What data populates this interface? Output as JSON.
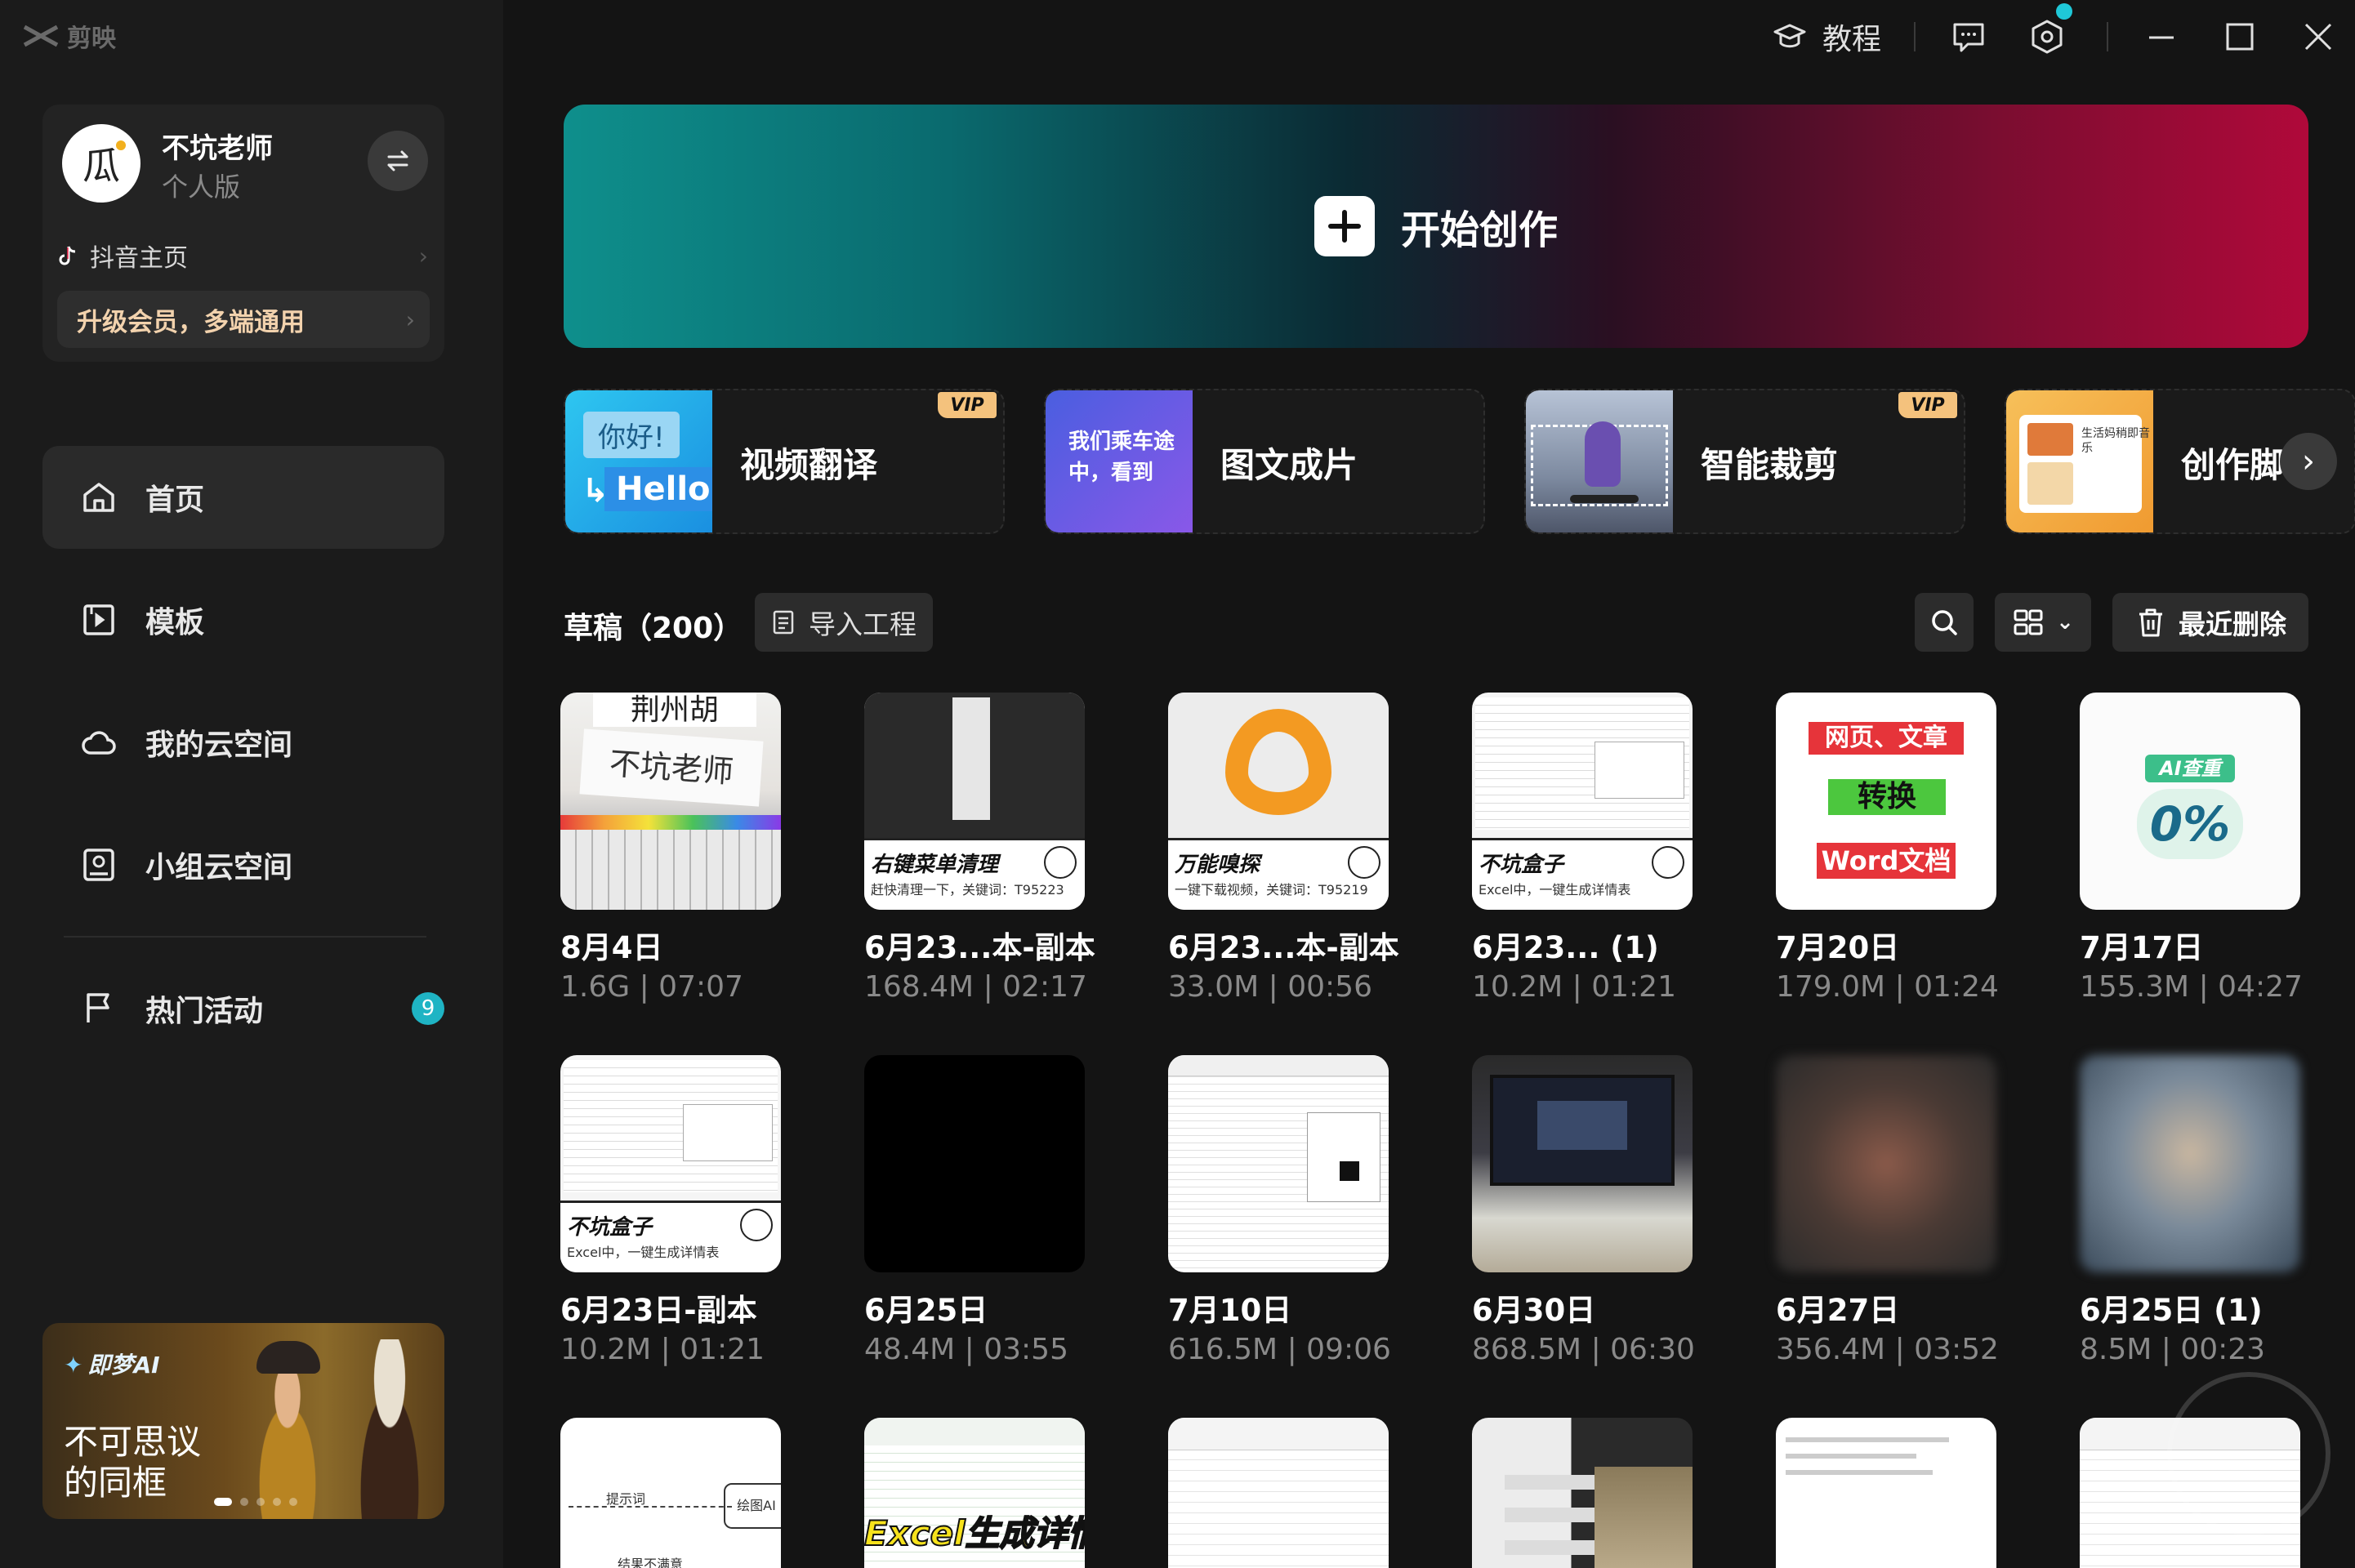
{
  "app": {
    "name": "剪映"
  },
  "user": {
    "name": "不坑老师",
    "plan": "个人版",
    "douyin_link": "抖音主页",
    "upgrade_text": "升级会员，多端通用"
  },
  "nav": {
    "items": [
      {
        "label": "首页",
        "icon": "home-icon",
        "active": true
      },
      {
        "label": "模板",
        "icon": "template-icon"
      },
      {
        "label": "我的云空间",
        "icon": "cloud-icon"
      },
      {
        "label": "小组云空间",
        "icon": "group-cloud-icon"
      },
      {
        "label": "热门活动",
        "icon": "flag-icon",
        "badge": "9"
      }
    ]
  },
  "promo": {
    "brand": "即梦AI",
    "line1": "不可思议",
    "line2": "的同框"
  },
  "topbar": {
    "tutorial_label": "教程",
    "icons": [
      "feedback-icon",
      "settings-icon",
      "minimize-icon",
      "maximize-icon",
      "close-icon"
    ]
  },
  "hero": {
    "label": "开始创作"
  },
  "tools": [
    {
      "label": "视频翻译",
      "vip": true,
      "thumb_bubble1": "你好!",
      "thumb_bubble2": "Hello"
    },
    {
      "label": "图文成片",
      "vip": false,
      "thumb_text": "我们乘车途中，看到"
    },
    {
      "label": "智能裁剪",
      "vip": true
    },
    {
      "label": "创作脚",
      "vip": false,
      "thumb_text": "生活妈稍即音乐"
    }
  ],
  "vip_label": "VIP",
  "drafts": {
    "title": "草稿（200）",
    "import_label": "导入工程",
    "recent_delete_label": "最近删除",
    "items": [
      {
        "date": "8月4日",
        "meta": "1.6G | 07:07",
        "thumb": "keyboard",
        "t1": "荆州胡",
        "t2": "不坑老师"
      },
      {
        "date": "6月23...本-副本",
        "meta": "168.4M | 02:17",
        "thumb": "caption-dark",
        "t1": "右键菜单清理",
        "t2": "赶快清理一下，关键词：T95223"
      },
      {
        "date": "6月23...本-副本",
        "meta": "33.0M | 00:56",
        "thumb": "caption-x",
        "t1": "万能嗅探",
        "t2": "一键下载视频，关键词：T95219"
      },
      {
        "date": "6月23... (1)",
        "meta": "10.2M | 01:21",
        "thumb": "caption-sheet",
        "t1": "不坑盒子",
        "t2": "Excel中，一键生成详情表"
      },
      {
        "date": "7月20日",
        "meta": "179.0M | 01:24",
        "thumb": "word",
        "t1": "网页、文章",
        "t2": "转换",
        "t3": "Word文档"
      },
      {
        "date": "7月17日",
        "meta": "155.3M | 04:27",
        "thumb": "ai",
        "t1": "AI查重",
        "t2": "0%"
      },
      {
        "date": "6月23日-副本",
        "meta": "10.2M | 01:21",
        "thumb": "caption-sheet",
        "t1": "不坑盒子",
        "t2": "Excel中，一键生成详情表"
      },
      {
        "date": "6月25日",
        "meta": "48.4M | 03:55",
        "thumb": "black"
      },
      {
        "date": "7月10日",
        "meta": "616.5M | 09:06",
        "thumb": "sheet"
      },
      {
        "date": "6月30日",
        "meta": "868.5M | 06:30",
        "thumb": "laptop"
      },
      {
        "date": "6月27日",
        "meta": "356.4M | 03:52",
        "thumb": "blur1"
      },
      {
        "date": "6月25日 (1)",
        "meta": "8.5M | 00:23",
        "thumb": "blur2"
      },
      {
        "thumb": "flow",
        "t1": "提示词",
        "t2": "绘图AI",
        "t3": "结果不满意"
      },
      {
        "thumb": "excel",
        "t1": "Excel生成详情"
      },
      {
        "thumb": "excel2"
      },
      {
        "thumb": "chat"
      },
      {
        "thumb": "doc"
      },
      {
        "thumb": "excel2"
      }
    ]
  }
}
